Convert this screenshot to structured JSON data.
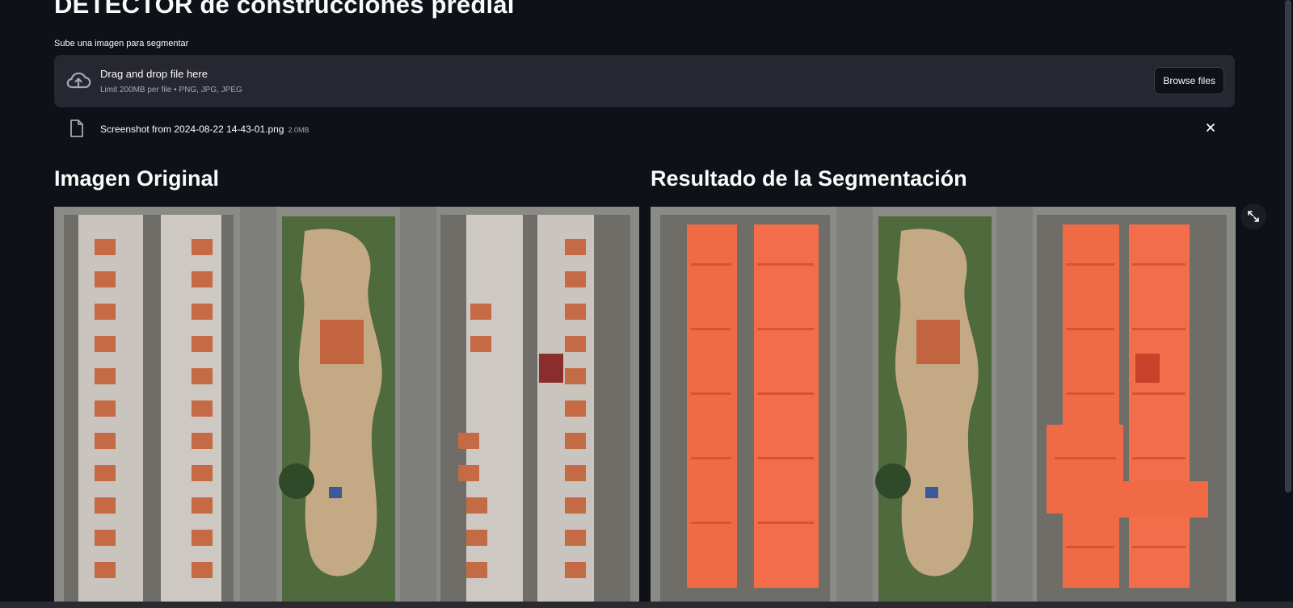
{
  "page": {
    "title": "DETECTOR de construcciones predial"
  },
  "uploader": {
    "label": "Sube una imagen para segmentar",
    "dropzone_text": "Drag and drop file here",
    "dropzone_hint": "Limit 200MB per file • PNG, JPG, JPEG",
    "browse_label": "Browse files",
    "icon": "cloud-upload-icon"
  },
  "uploaded_file": {
    "name": "Screenshot from 2024-08-22 14-43-01.png",
    "size": "2.0MB",
    "icon": "file-icon",
    "remove_icon": "close-icon"
  },
  "columns": {
    "original_title": "Imagen Original",
    "result_title": "Resultado de la Segmentación"
  },
  "colors": {
    "background": "#0e1117",
    "panel": "#262730",
    "text": "#fafafa",
    "muted": "#a3a8b8",
    "segmentation_overlay": "#ff5a32"
  }
}
